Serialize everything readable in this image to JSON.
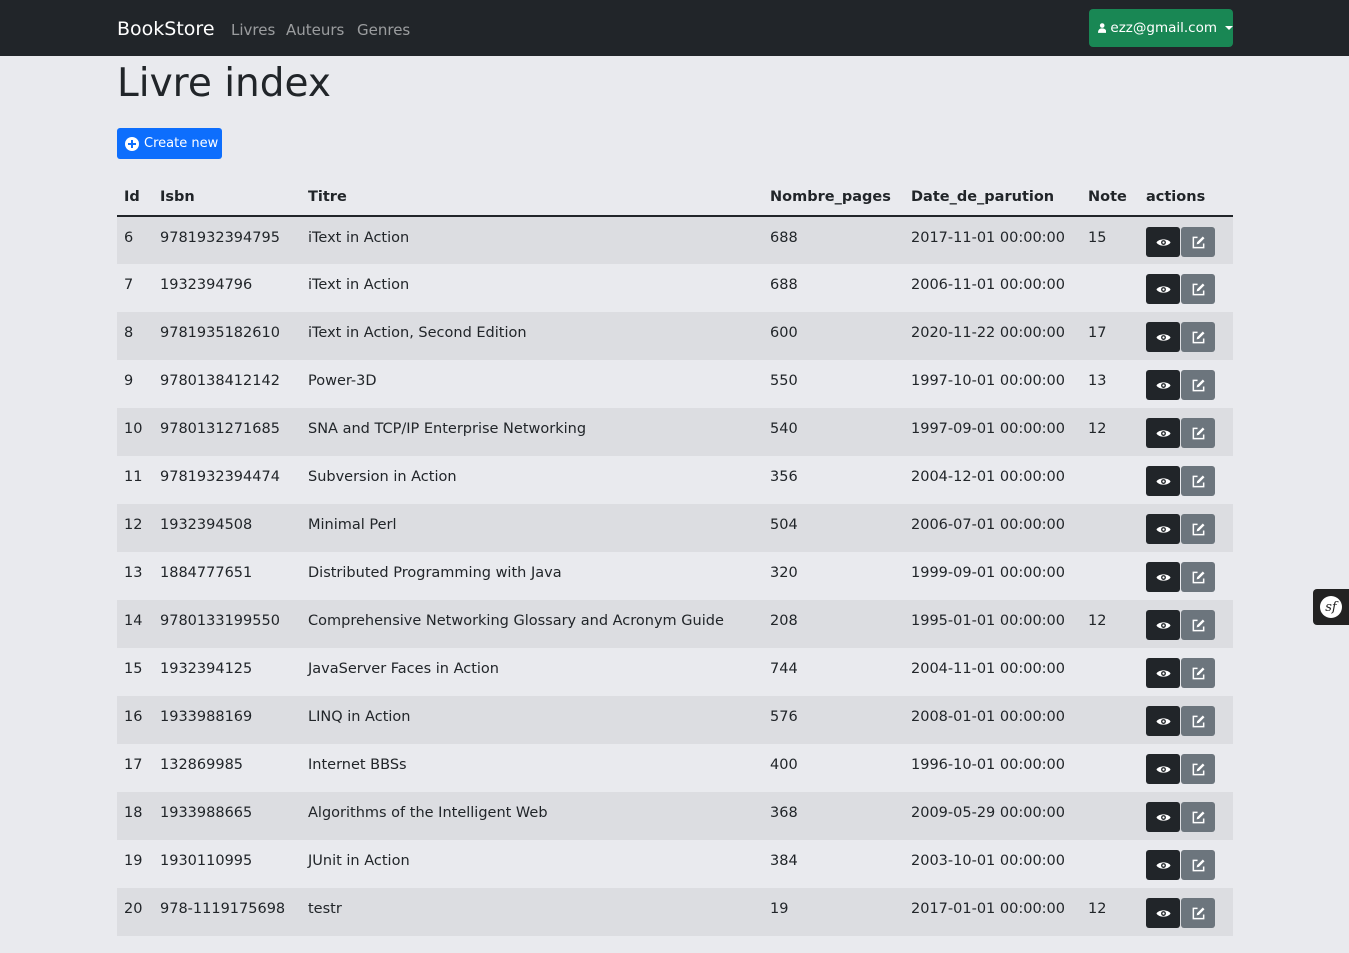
{
  "navbar": {
    "brand": "BookStore",
    "links": [
      "Livres",
      "Auteurs",
      "Genres"
    ],
    "user": "ezz@gmail.com"
  },
  "page": {
    "title": "Livre index",
    "create_label": "Create new"
  },
  "table": {
    "headers": [
      "Id",
      "Isbn",
      "Titre",
      "Nombre_pages",
      "Date_de_parution",
      "Note",
      "actions"
    ],
    "rows": [
      [
        "6",
        "9781932394795",
        "iText in Action",
        "688",
        "2017-11-01 00:00:00",
        "15"
      ],
      [
        "7",
        "1932394796",
        "iText in Action",
        "688",
        "2006-11-01 00:00:00",
        ""
      ],
      [
        "8",
        "9781935182610",
        "iText in Action, Second Edition",
        "600",
        "2020-11-22 00:00:00",
        "17"
      ],
      [
        "9",
        "9780138412142",
        "Power-3D",
        "550",
        "1997-10-01 00:00:00",
        "13"
      ],
      [
        "10",
        "9780131271685",
        "SNA and TCP/IP Enterprise Networking",
        "540",
        "1997-09-01 00:00:00",
        "12"
      ],
      [
        "11",
        "9781932394474",
        "Subversion in Action",
        "356",
        "2004-12-01 00:00:00",
        ""
      ],
      [
        "12",
        "1932394508",
        "Minimal Perl",
        "504",
        "2006-07-01 00:00:00",
        ""
      ],
      [
        "13",
        "1884777651",
        "Distributed Programming with Java",
        "320",
        "1999-09-01 00:00:00",
        ""
      ],
      [
        "14",
        "9780133199550",
        "Comprehensive Networking Glossary and Acronym Guide",
        "208",
        "1995-01-01 00:00:00",
        "12"
      ],
      [
        "15",
        "1932394125",
        "JavaServer Faces in Action",
        "744",
        "2004-11-01 00:00:00",
        ""
      ],
      [
        "16",
        "1933988169",
        "LINQ in Action",
        "576",
        "2008-01-01 00:00:00",
        ""
      ],
      [
        "17",
        "132869985",
        "Internet BBSs",
        "400",
        "1996-10-01 00:00:00",
        ""
      ],
      [
        "18",
        "1933988665",
        "Algorithms of the Intelligent Web",
        "368",
        "2009-05-29 00:00:00",
        ""
      ],
      [
        "19",
        "1930110995",
        "JUnit in Action",
        "384",
        "2003-10-01 00:00:00",
        ""
      ],
      [
        "20",
        "978-1119175698",
        "testr",
        "19",
        "2017-01-01 00:00:00",
        "12"
      ]
    ]
  },
  "icons": {
    "user": "user-icon",
    "create": "plus-circle-icon",
    "show": "eye-icon",
    "edit": "edit-icon",
    "debug": "symfony-icon"
  },
  "colors": {
    "navbar": "#212529",
    "user_button": "#198754",
    "create_button": "#0d6efd",
    "show_button": "#212529",
    "edit_button": "#6c757d"
  }
}
